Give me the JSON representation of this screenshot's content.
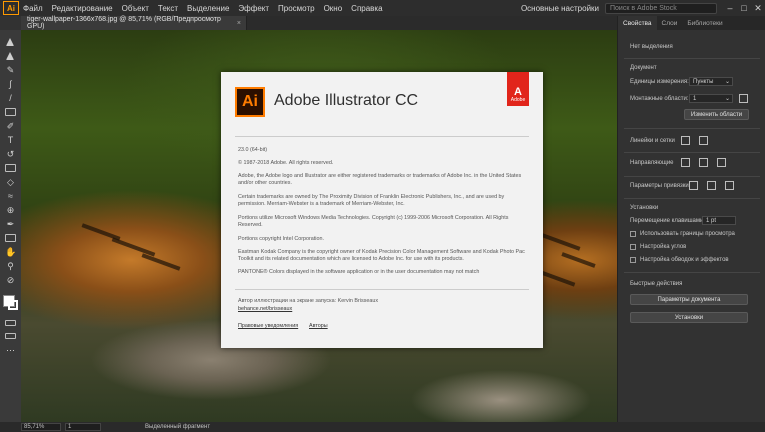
{
  "app": {
    "logo": "Ai"
  },
  "menu": [
    "Файл",
    "Редактирование",
    "Объект",
    "Текст",
    "Выделение",
    "Эффект",
    "Просмотр",
    "Окно",
    "Справка"
  ],
  "workspace": "Основные настройки",
  "search_placeholder": "Поиск в Adobe Stock",
  "doc_tab": {
    "title": "tiger-wallpaper-1366x768.jpg @ 85,71% (RGB/Предпросмотр GPU)",
    "close": "×"
  },
  "splash": {
    "badge": "Ai",
    "title": "Adobe Illustrator CC",
    "adobe_tag": "Adobe",
    "version": "23.0 (64-bit)",
    "copyright": "© 1987-2018 Adobe. All rights reserved.",
    "p1": "Adobe, the Adobe logo and Illustrator are either registered trademarks or trademarks of Adobe Inc. in the United States and/or other countries.",
    "p2": "Certain trademarks are owned by The Proximity Division of Franklin Electronic Publishers, Inc., and are used by permission. Merriam-Webster is a trademark of Merriam-Webster, Inc.",
    "p3": "Portions utilize Microsoft Windows Media Technologies. Copyright (c) 1999-2006 Microsoft Corporation. All Rights Reserved.",
    "p4": "Portions copyright Intel Corporation.",
    "p5": "Eastman Kodak Company is the copyright owner of Kodak Precision Color Management Software and Kodak Photo Pac Toolkit and its related documentation which are licensed to Adobe Inc. for use with its products.",
    "p6": "PANTONE® Colors displayed in the software application or in the user documentation may not match",
    "artist_label": "Автор иллюстрации на экране запуска: Kervin Brisseaux",
    "artist_link": "behance.net/brisseaux",
    "legal_link": "Правовые уведомления",
    "authors_link": "Авторы"
  },
  "panel": {
    "tabs": [
      "Свойства",
      "Слои",
      "Библиотеки"
    ],
    "no_selection": "Нет выделения",
    "document": "Документ",
    "units_label": "Единицы измерения:",
    "units_value": "Пункты",
    "artboard_label": "Монтажные области:",
    "artboard_value": "1",
    "change_artboards": "Изменить области",
    "rulers": "Линейки и сетки",
    "guides": "Направляющие",
    "snap": "Параметры привязки",
    "prefs": "Установки",
    "keyboard_inc": "Перемещение клавишами:",
    "keyboard_value": "1 pt",
    "chk1": "Использовать границы просмотра",
    "chk2": "Настройка углов",
    "chk3": "Настройка обводок и эффектов",
    "quick": "Быстрые действия",
    "doc_setup": "Параметры документа",
    "preferences": "Установки"
  },
  "status": {
    "zoom": "85,71%",
    "artboard": "1",
    "selection": "Выделенный фрагмент"
  }
}
